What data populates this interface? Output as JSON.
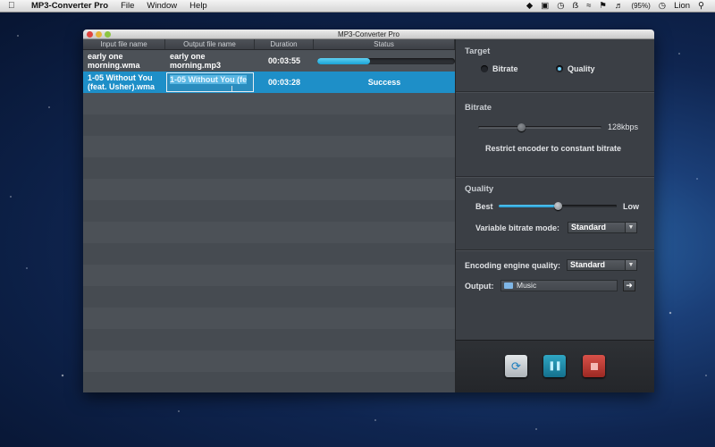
{
  "menubar": {
    "app_name": "MP3-Converter Pro",
    "menus": [
      "File",
      "Window",
      "Help"
    ],
    "battery": "(95%)",
    "user": "Lion"
  },
  "window": {
    "title": "MP3-Converter Pro"
  },
  "table": {
    "headers": {
      "input": "Input file name",
      "output": "Output file name",
      "duration": "Duration",
      "status": "Status"
    },
    "rows": [
      {
        "input": "early one morning.wma",
        "output": "early one morning.mp3",
        "duration": "00:03:55",
        "status": "",
        "progress": 0.38
      },
      {
        "input": "1-05 Without You (feat. Usher).wma",
        "output": "1-05 Without You (fe",
        "duration": "00:03:28",
        "status": "Success"
      }
    ]
  },
  "panel": {
    "target": {
      "title": "Target",
      "options": [
        "Bitrate",
        "Quality"
      ],
      "selected": "Quality"
    },
    "bitrate": {
      "title": "Bitrate",
      "value_label": "128kbps",
      "level": 0.35,
      "restrict_label": "Restrict encoder to constant bitrate"
    },
    "quality": {
      "title": "Quality",
      "best_label": "Best",
      "low_label": "Low",
      "level": 0.5,
      "vbr_label": "Variable bitrate mode:",
      "vbr_value": "Standard"
    },
    "engine": {
      "label": "Encoding engine quality:",
      "value": "Standard",
      "output_label": "Output:",
      "output_value": "Music"
    }
  },
  "colors": {
    "accent": "#1e8fc8",
    "stop": "#c0392b",
    "pause": "#1f8aa8"
  }
}
